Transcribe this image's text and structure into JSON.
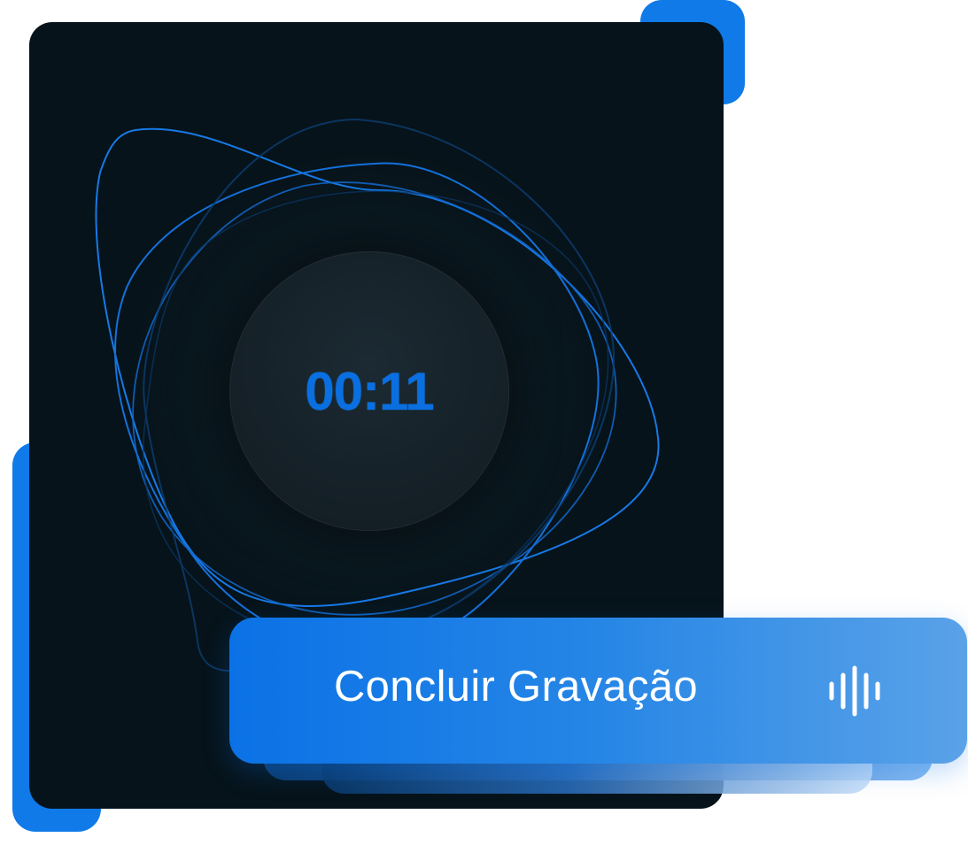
{
  "timer": {
    "elapsed": "00:11"
  },
  "action": {
    "label": "Concluir Gravação",
    "icon": "audio-waveform-icon"
  },
  "colors": {
    "accent": "#0f7ae8",
    "panel_background": "#06131a",
    "timer_text": "#0a6fe0",
    "button_gradient_start": "#0b72e6",
    "button_gradient_end": "#5aa2e8",
    "button_text": "#ffffff"
  }
}
